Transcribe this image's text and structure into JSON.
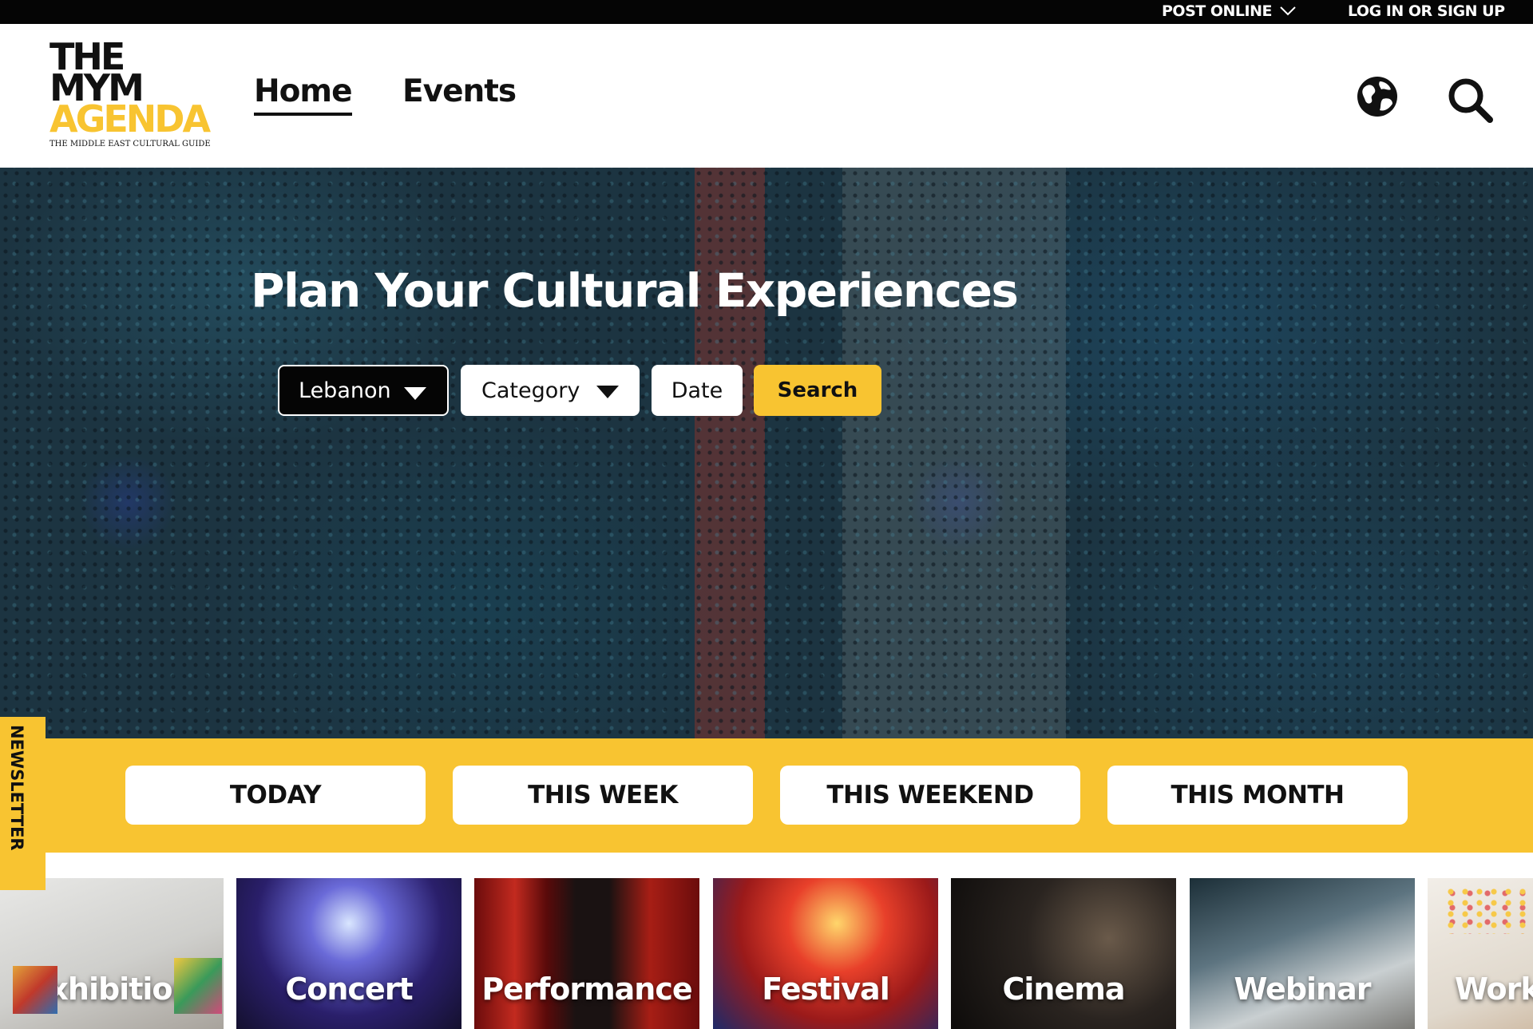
{
  "topbar": {
    "post_online": "POST ONLINE",
    "login": "LOG IN OR SIGN UP"
  },
  "logo": {
    "line1": "THE",
    "line2": "MYM",
    "line3": "AGENDA",
    "tagline": "THE MIDDLE EAST CULTURAL GUIDE"
  },
  "nav": {
    "home": "Home",
    "events": "Events"
  },
  "hero": {
    "title": "Plan Your Cultural Experiences",
    "country": "Lebanon",
    "category": "Category",
    "date": "Date",
    "search": "Search"
  },
  "quick_filters": [
    "TODAY",
    "THIS WEEK",
    "THIS WEEKEND",
    "THIS MONTH"
  ],
  "newsletter": "NEWSLETTER",
  "categories": [
    "Exhibition",
    "Concert",
    "Performance",
    "Festival",
    "Cinema",
    "Webinar",
    "Workshop"
  ],
  "colors": {
    "brand_yellow": "#f8c431",
    "black": "#050505"
  },
  "icons": {
    "globe": "globe-icon",
    "search": "search-icon",
    "chevron": "chevron-down-icon",
    "caret": "caret-down-icon"
  }
}
